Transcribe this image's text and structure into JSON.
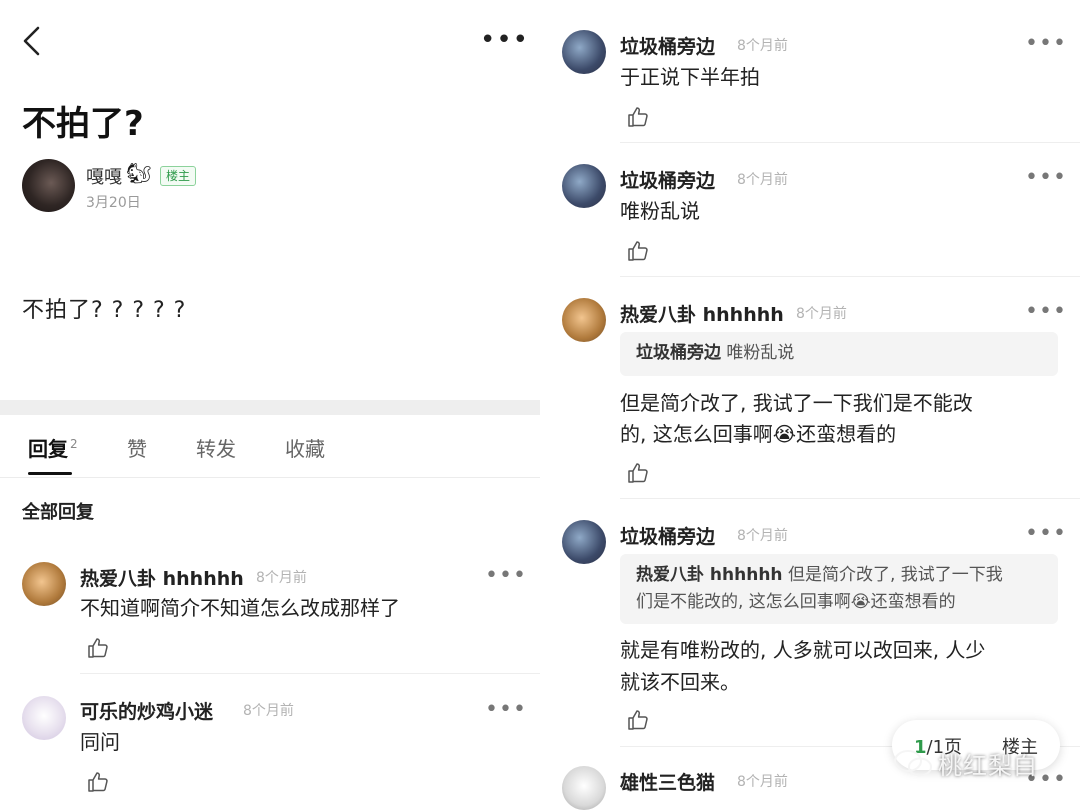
{
  "left": {
    "post": {
      "title": "不拍了?",
      "author": "嘎嘎",
      "author_emoji": "🐿",
      "op_badge": "楼主",
      "date": "3月20日",
      "body": "不拍了? ? ? ? ?"
    },
    "tabs": [
      {
        "label": "回复",
        "count": "2"
      },
      {
        "label": "赞"
      },
      {
        "label": "转发"
      },
      {
        "label": "收藏"
      }
    ],
    "section_title": "全部回复",
    "comments": [
      {
        "name": "热爱八卦 hhhhhh",
        "time": "8个月前",
        "text": "不知道啊简介不知道怎么改成那样了"
      },
      {
        "name": "可乐的炒鸡小迷",
        "time": "8个月前",
        "text": "同问"
      }
    ]
  },
  "right": {
    "comments": [
      {
        "name": "垃圾桶旁边",
        "time": "8个月前",
        "text": "于正说下半年拍"
      },
      {
        "name": "垃圾桶旁边",
        "time": "8个月前",
        "text": "唯粉乱说"
      },
      {
        "name": "热爱八卦 hhhhhh",
        "time": "8个月前",
        "quote_name": "垃圾桶旁边",
        "quote_text": "唯粉乱说",
        "text_line1": "但是简介改了, 我试了一下我们是不能改",
        "text_line2": "的, 这怎么回事啊😭还蛮想看的"
      },
      {
        "name": "垃圾桶旁边",
        "time": "8个月前",
        "quote_name": "热爱八卦 hhhhhh",
        "quote_line1": "但是简介改了, 我试了一下我",
        "quote_line2": "们是不能改的, 这怎么回事啊😭还蛮想看的",
        "text_line1": "就是有唯粉改的, 人多就可以改回来, 人少",
        "text_line2": "就该不回来。"
      },
      {
        "name": "雄性三色猫",
        "time": "8个月前"
      }
    ],
    "pager": {
      "current": "1",
      "total_label": "/1页",
      "op_label": "楼主"
    },
    "watermark": "桃红梨白"
  },
  "icons": {
    "back": "back-arrow-icon",
    "more": "more-dots-icon",
    "like": "thumbs-up-icon"
  }
}
